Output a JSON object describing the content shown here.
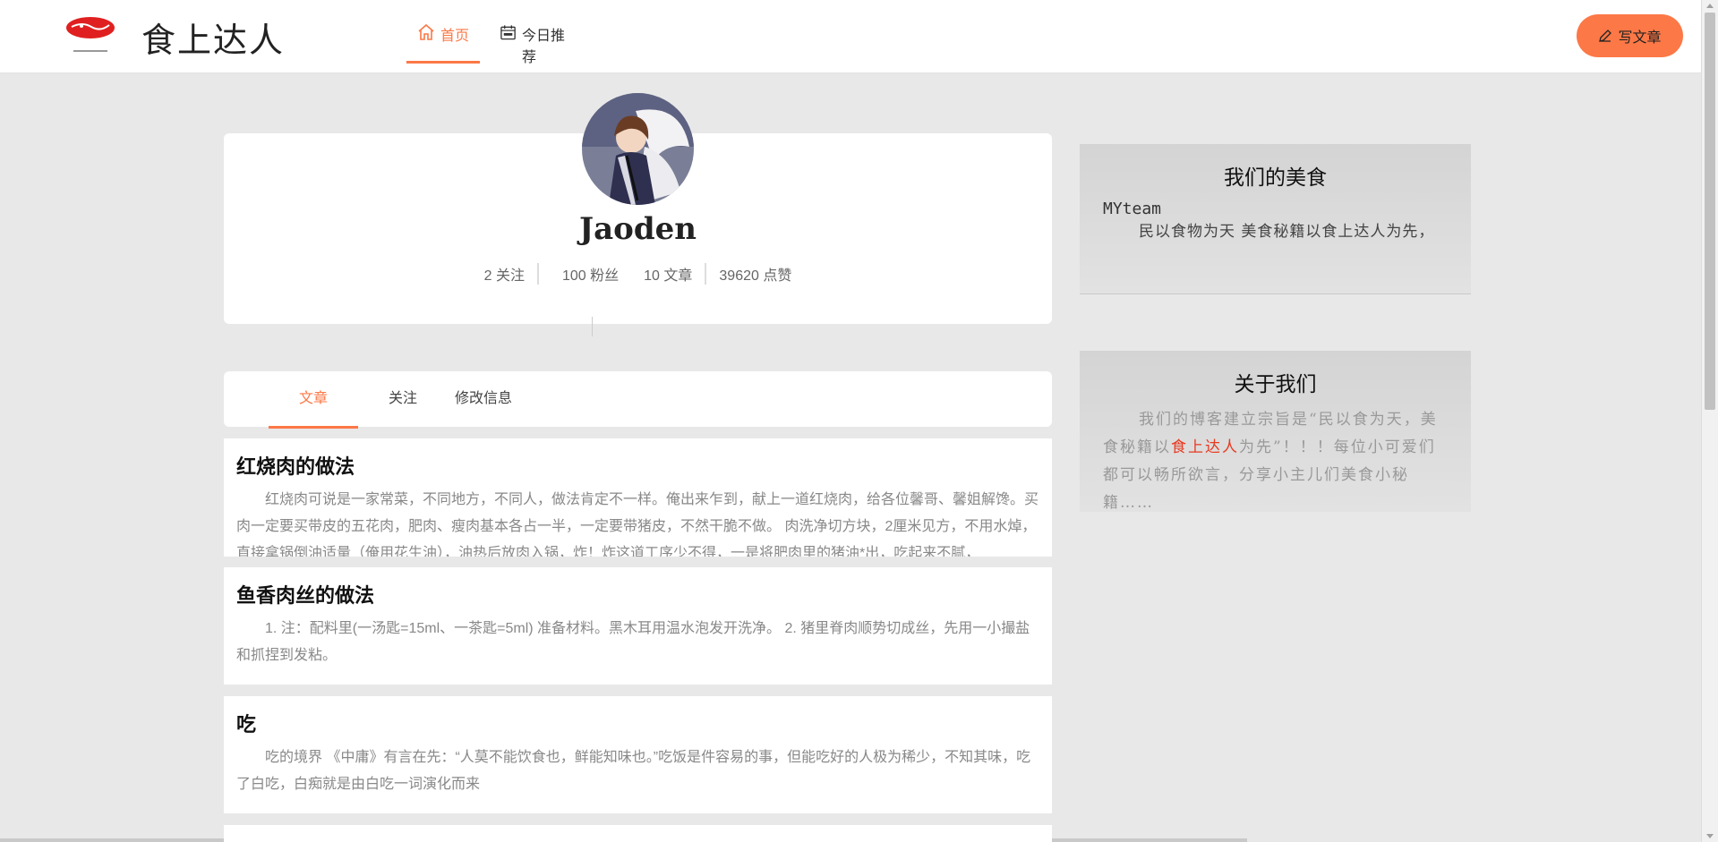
{
  "header": {
    "brand": "食上达人",
    "logo_text": "食上达人",
    "nav": [
      {
        "label": "首页",
        "icon": "home-icon",
        "active": true
      },
      {
        "label": "今日推荐",
        "icon": "calendar-sale-icon",
        "active": false
      }
    ],
    "write_button": "写文章",
    "accent_color": "#fc7846"
  },
  "profile": {
    "username": "Jaoden",
    "stats": {
      "following": "2 关注",
      "followers": "100 粉丝",
      "articles": "10 文章",
      "likes": "39620 点赞"
    }
  },
  "tabs": [
    {
      "label": "文章",
      "active": true
    },
    {
      "label": "关注",
      "active": false
    },
    {
      "label": "修改信息",
      "active": false
    }
  ],
  "articles": [
    {
      "title": "红烧肉的做法",
      "body": "红烧肉可说是一家常菜，不同地方，不同人，做法肯定不一样。俺出来乍到，献上一道红烧肉，给各位馨哥、馨姐解馋。买肉一定要买带皮的五花肉，肥肉、瘦肉基本各占一半，一定要带猪皮，不然干脆不做。 肉洗净切方块，2厘米见方，不用水焯，直接拿锅倒油适量（俺用花生油），油热后放肉入锅，炸！炸这道工序少不得，一是将肥肉里的猪油*出，吃起来不腻，"
    },
    {
      "title": "鱼香肉丝的做法",
      "body": "1. 注：配料里(一汤匙=15ml、一茶匙=5ml)        准备材料。黑木耳用温水泡发开洗净。        2. 猪里脊肉顺势切成丝，先用一小撮盐和抓捏到发粘。"
    },
    {
      "title": "吃",
      "body": "吃的境界 《中庸》有言在先：“人莫不能饮食也，鲜能知味也。”吃饭是件容易的事，但能吃好的人极为稀少，不知其味，吃了白吃，白痴就是由白吃一词演化而来"
    }
  ],
  "sidebar": {
    "food": {
      "title": "我们的美食",
      "team": "MYteam",
      "text": "民以食物为天 美食秘籍以食上达人为先，"
    },
    "about": {
      "title": "关于我们",
      "text_before": "我们的博客建立宗旨是“民以食为天，美食秘籍以",
      "highlight": "食上达人",
      "text_after": "为先”！！！每位小可爱们都可以畅所欲言，分享小主儿们美食小秘籍……",
      "highlight_color": "#e83a20"
    }
  }
}
